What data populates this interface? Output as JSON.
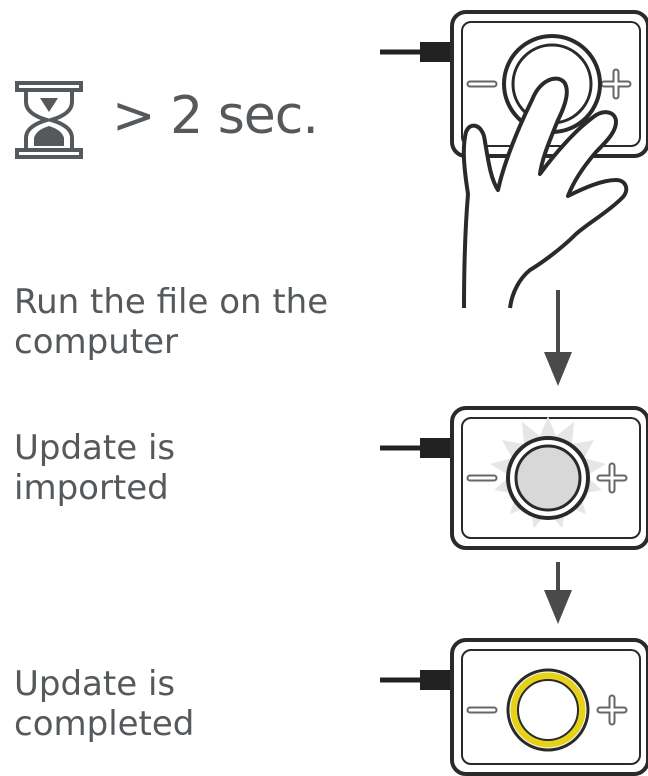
{
  "step1": {
    "duration": "> 2 sec.",
    "icons": [
      "hourglass-icon",
      "hand-press-icon"
    ]
  },
  "step2": {
    "line1": "Run the file on the",
    "line2": "computer"
  },
  "step3": {
    "line1": "Update is",
    "line2": "imported",
    "indicator": "glowing-gray"
  },
  "step4": {
    "line1": "Update is",
    "line2": "completed",
    "indicator": "yellow-ring"
  },
  "device": {
    "minus_symbol": "minus-icon",
    "plus_symbol": "plus-icon"
  },
  "colors": {
    "text": "#55595c",
    "outline": "#2a2a2a",
    "pressed_knob": "#d8d8d8",
    "glow": "#e6e6e6",
    "complete_ring": "#e6d21a"
  }
}
